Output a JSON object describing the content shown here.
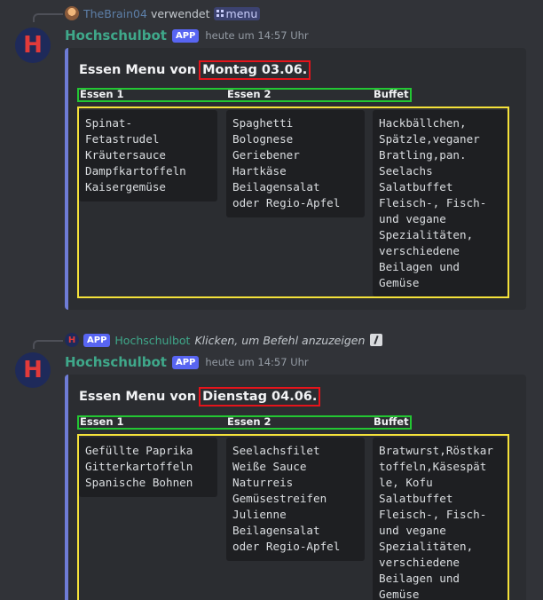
{
  "reply1": {
    "user": "TheBrain04",
    "verb": "verwendet",
    "command": "menu"
  },
  "message1": {
    "bot_name": "Hochschulbot",
    "badge": "APP",
    "timestamp": "heute um 14:57 Uhr",
    "title_prefix": "Essen Menu von",
    "title_date": "Montag 03.06.",
    "field_names": [
      "Essen 1",
      "Essen 2",
      "Buffet"
    ],
    "fields": [
      [
        "Spinat-",
        "Fetastrudel",
        "Kräutersauce",
        "Dampfkartoffeln",
        "Kaisergemüse"
      ],
      [
        "Spaghetti",
        "Bolognese",
        "Geriebener",
        "Hartkäse",
        "Beilagensalat",
        "oder Regio-Apfel"
      ],
      [
        "Hackbällchen,",
        "Spätzle,veganer",
        "Bratling,pan.",
        "Seelachs",
        "Salatbuffet",
        "Fleisch-, Fisch-",
        "und vegane",
        "Spezialitäten,",
        "verschiedene",
        "Beilagen und",
        "Gemüse"
      ]
    ]
  },
  "reply2": {
    "badge": "APP",
    "bot_name": "Hochschulbot",
    "text": "Klicken, um Befehl anzuzeigen"
  },
  "message2": {
    "bot_name": "Hochschulbot",
    "badge": "APP",
    "timestamp": "heute um 14:57 Uhr",
    "title_prefix": "Essen Menu von",
    "title_date": "Dienstag 04.06.",
    "field_names": [
      "Essen 1",
      "Essen 2",
      "Buffet"
    ],
    "fields": [
      [
        "Gefüllte Paprika",
        "Gitterkartoffeln",
        "Spanische Bohnen"
      ],
      [
        "Seelachsfilet",
        "Weiße Sauce",
        "Naturreis",
        "Gemüsestreifen",
        "Julienne",
        "Beilagensalat",
        "oder Regio-Apfel"
      ],
      [
        "Bratwurst,Röstkar",
        "toffeln,Käsespät",
        "le, Kofu",
        "Salatbuffet",
        "Fleisch-, Fisch-",
        "und vegane",
        "Spezialitäten,",
        "verschiedene",
        "Beilagen und",
        "Gemüse"
      ]
    ]
  },
  "avatar_letter": "H",
  "colors": {
    "background": "#313338",
    "embed": "#2b2d31",
    "embed_accent": "#6e7cd6",
    "bot_name": "#3fa88a",
    "app_badge": "#5865f2",
    "date_box": "#e5141b",
    "header_box": "#23c733",
    "body_box": "#f5e23a"
  }
}
